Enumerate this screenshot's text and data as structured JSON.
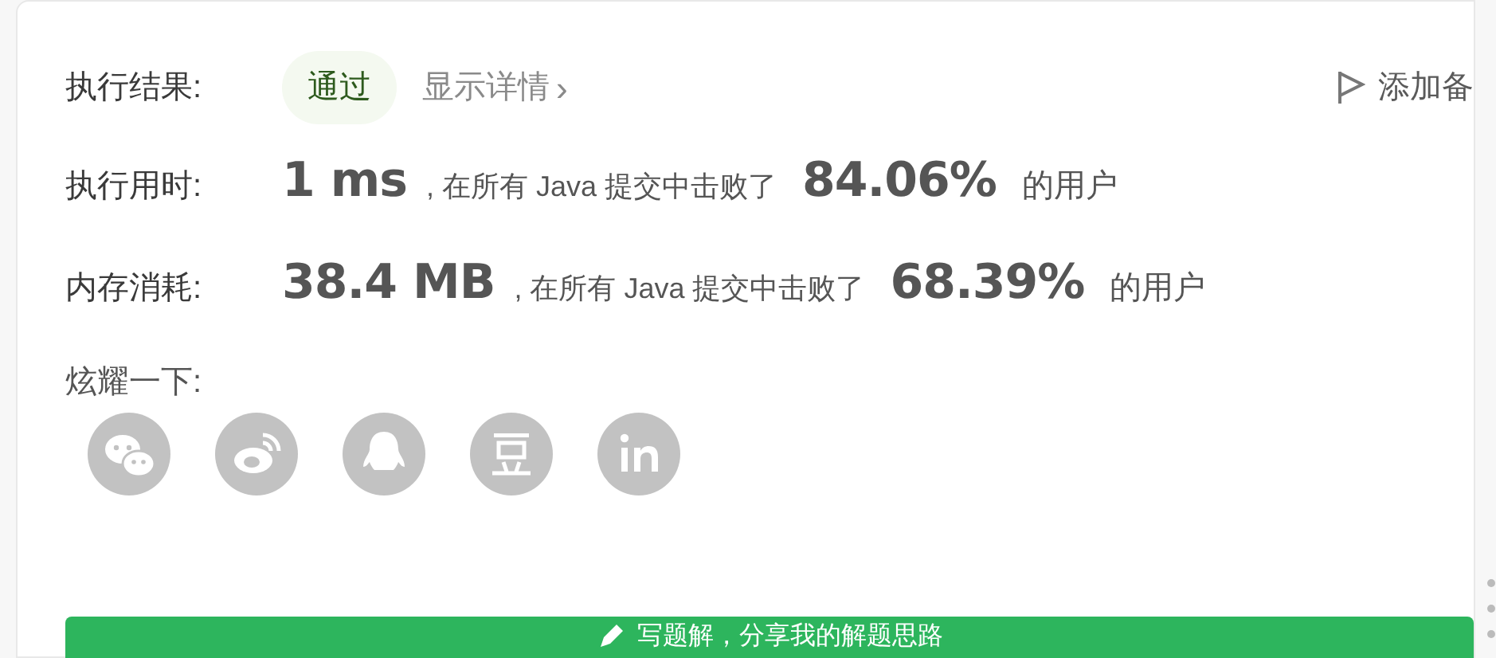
{
  "result": {
    "label": "执行结果:",
    "status": "通过",
    "details_link": "显示详情",
    "details_arrow": "›",
    "add_note": "添加备"
  },
  "stats": [
    {
      "label": "执行用时:",
      "value": "1 ms",
      "middle": ", 在所有 Java 提交中击败了",
      "percent": "84.06%",
      "suffix": "的用户"
    },
    {
      "label": "内存消耗:",
      "value": "38.4 MB",
      "middle": ", 在所有 Java 提交中击败了",
      "percent": "68.39%",
      "suffix": "的用户"
    }
  ],
  "share": {
    "label": "炫耀一下:",
    "icons": [
      {
        "kind": "wechat"
      },
      {
        "kind": "weibo"
      },
      {
        "kind": "qq"
      },
      {
        "kind": "douban"
      },
      {
        "kind": "linkedin"
      }
    ]
  },
  "write_button": {
    "label": "写题解，分享我的解题思路"
  }
}
